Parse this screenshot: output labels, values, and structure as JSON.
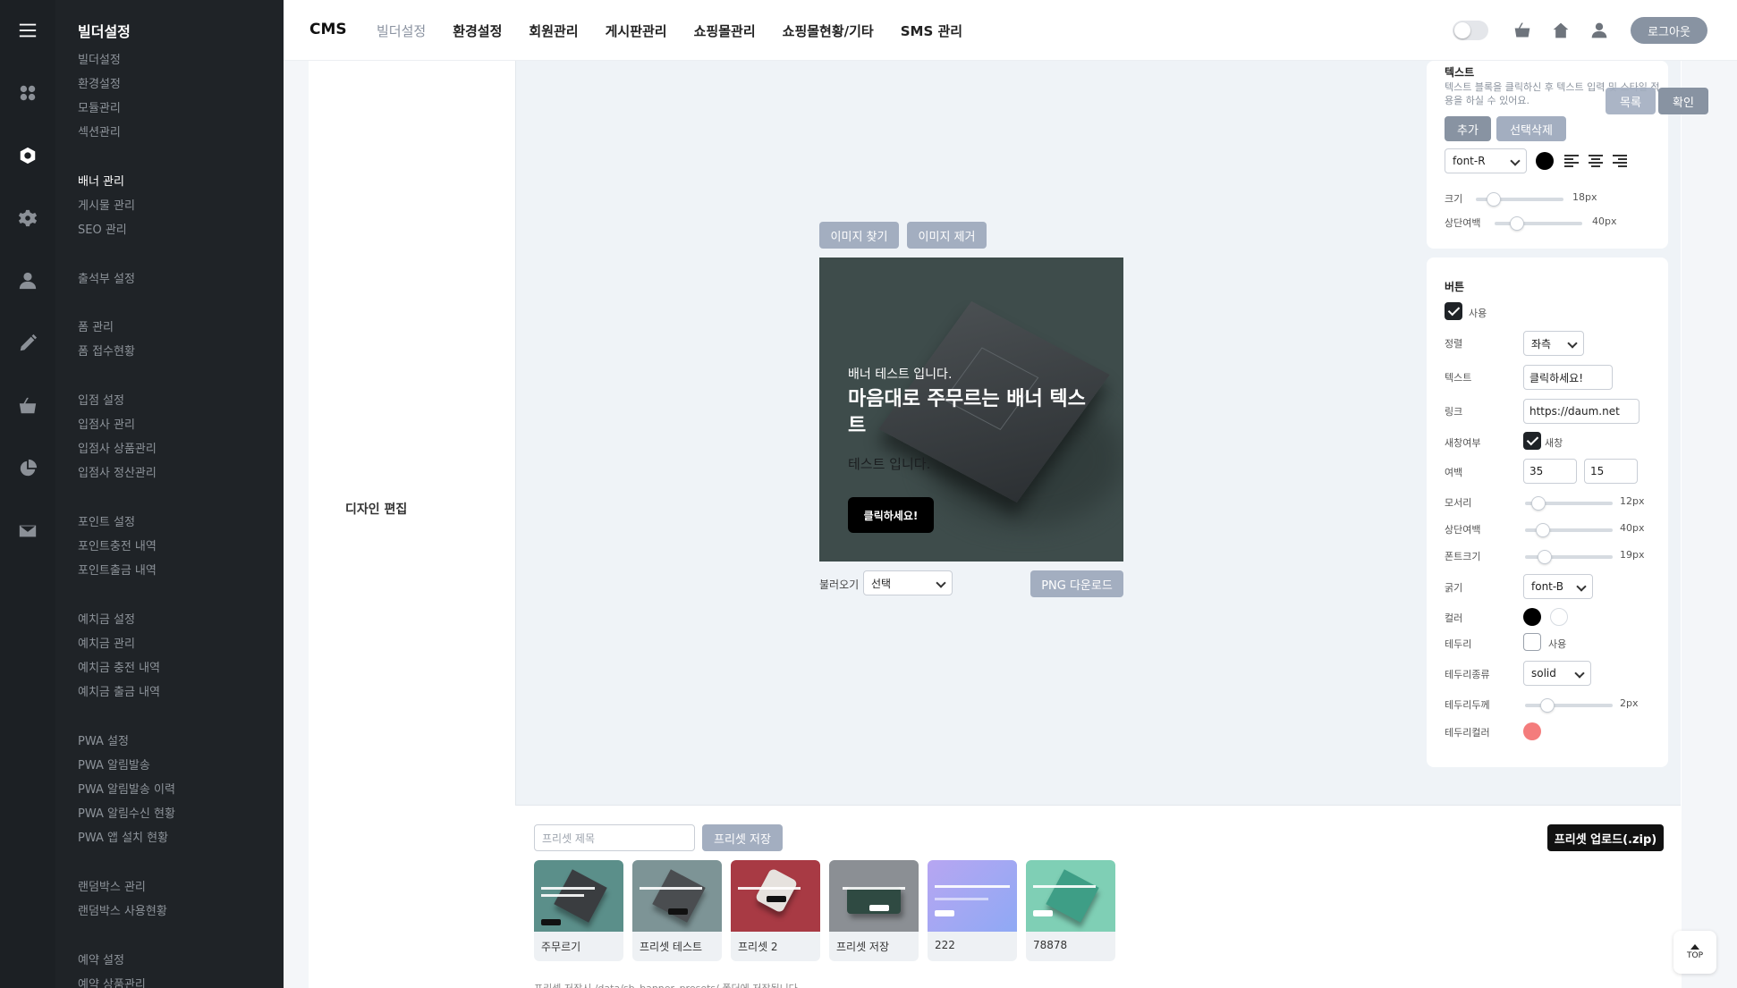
{
  "sidebar": {
    "title": "빌더설정",
    "items": [
      "빌더설정",
      "환경설정",
      "모듈관리",
      "섹션관리",
      "배너 관리",
      "게시물 관리",
      "SEO 관리",
      "출석부 설정",
      "폼 관리",
      "폼 접수현황",
      "입점 설정",
      "입점사 관리",
      "입점사 상품관리",
      "입점사 정산관리",
      "포인트 설정",
      "포인트충전 내역",
      "포인트출금 내역",
      "예치금 설정",
      "예치금 관리",
      "예치금 충전 내역",
      "예치금 출금 내역",
      "PWA 설정",
      "PWA 알림발송",
      "PWA 알림발송 이력",
      "PWA 알림수신 현황",
      "PWA 앱 설치 현황",
      "랜덤박스 관리",
      "랜덤박스 사용현황",
      "예약 설정",
      "예약 상품관리"
    ],
    "active_item": "배너 관리"
  },
  "rail_icons": [
    "menu-icon",
    "grid-icon",
    "builder-icon",
    "gear-icon",
    "user-icon",
    "pencil-icon",
    "basket-icon",
    "pie-chart-icon",
    "mail-icon"
  ],
  "header": {
    "brand": "CMS",
    "nav": [
      "빌더설정",
      "환경설정",
      "회원관리",
      "게시판관리",
      "쇼핑몰관리",
      "쇼핑몰현황/기타",
      "SMS 관리"
    ],
    "active_nav": "빌더설정",
    "logout_label": "로그아웃"
  },
  "editor": {
    "section_label": "디자인 편집",
    "find_image_label": "이미지 찾기",
    "remove_image_label": "이미지 제거",
    "list_label": "목록",
    "confirm_label": "확인",
    "load_label": "불러오기",
    "load_select_value": "선택",
    "png_download_label": "PNG 다운로드"
  },
  "banner": {
    "subtitle": "배너 테스트 입니다.",
    "headline": "마음대로 주무르는 배너 텍스트",
    "body": "테스트 입니다.",
    "cta": "클릭하세요!"
  },
  "text_panel": {
    "title": "텍스트",
    "description": "텍스트 블록을 클릭하신 후 텍스트 입력 및 스타일 적용을 하실 수 있어요.",
    "add_label": "추가",
    "delete_label": "선택삭제",
    "font_value": "font-R",
    "color": "#000000",
    "size_label": "크기",
    "size_value": "18px",
    "size_level": 0.2,
    "top_margin_label": "상단여백",
    "top_margin_value": "40px",
    "top_margin_level": 0.25
  },
  "button_panel": {
    "title": "버튼",
    "use_label": "사용",
    "align_label": "정렬",
    "align_value": "좌측",
    "text_label": "텍스트",
    "text_value": "클릭하세요!",
    "link_label": "링크",
    "link_value": "https://daum.net",
    "new_window_label": "새창여부",
    "new_window_value": "새창",
    "padding_label": "여백",
    "padding_x": "35",
    "padding_y": "15",
    "radius_label": "모서리",
    "radius_value": "12px",
    "radius_level": 0.15,
    "margin_top_label": "상단여백",
    "margin_top_value": "40px",
    "margin_top_level": 0.2,
    "font_size_label": "폰트크기",
    "font_size_value": "19px",
    "font_size_level": 0.22,
    "weight_label": "굵기",
    "weight_value": "font-B",
    "color_label": "컬러",
    "color_bg": "#000000",
    "color_text": "#ffffff",
    "border_label": "테두리",
    "border_use_label": "사용",
    "border_type_label": "테두리종류",
    "border_type_value": "solid",
    "border_width_label": "테두리두께",
    "border_width_value": "2px",
    "border_width_level": 0.25,
    "border_color_label": "테두리컬러",
    "border_color": "#f47c7c"
  },
  "presets": {
    "title_placeholder": "프리셋 제목",
    "save_label": "프리셋 저장",
    "upload_label": "프리셋 업로드(.zip)",
    "items": [
      {
        "name": "주무르기",
        "bg": "#5b8f8a",
        "box": "#3a3d40"
      },
      {
        "name": "프리셋 테스트",
        "bg": "#7d9496",
        "box": "#4a4d50"
      },
      {
        "name": "프리셋 2",
        "bg": "#a83a44",
        "box": "#e6e2de"
      },
      {
        "name": "프리셋 저장",
        "bg": "#8b8f94",
        "box": "#2f4a42"
      },
      {
        "name": "222",
        "bg": "#9fa6f4",
        "box": ""
      },
      {
        "name": "78878",
        "bg": "#7fcfb5",
        "box": "#3e9e86"
      }
    ],
    "footnote": "프리셋 저장시 /data/sb_banner_presets/ 폴더에 저장됩니다."
  },
  "top_button_label": "TOP"
}
